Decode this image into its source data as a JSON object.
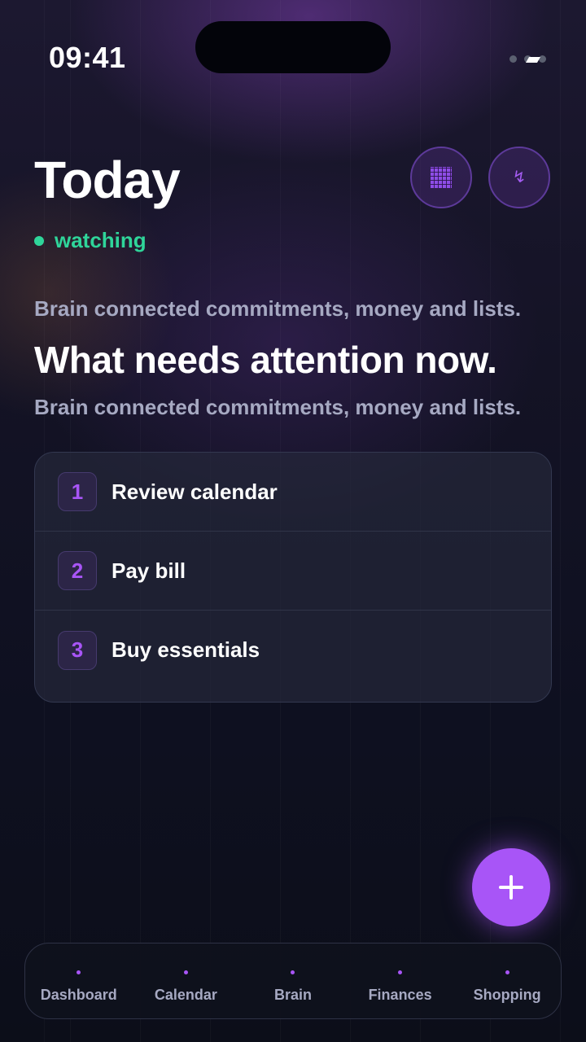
{
  "status_bar": {
    "time": "09:41"
  },
  "header": {
    "title": "Today",
    "status_text": "watching",
    "buttons": [
      {
        "icon": "calendar-grid-icon"
      },
      {
        "icon": "bolt-icon"
      }
    ]
  },
  "intro": {
    "kicker": "Brain connected commitments, money and lists.",
    "headline": "What needs attention now.",
    "subline": "Brain connected commitments, money and lists."
  },
  "tasks": [
    {
      "number": "1",
      "label": "Review calendar"
    },
    {
      "number": "2",
      "label": "Pay bill"
    },
    {
      "number": "3",
      "label": "Buy essentials"
    }
  ],
  "fab": {
    "icon": "plus-icon"
  },
  "nav": {
    "items": [
      {
        "label": "Dashboard"
      },
      {
        "label": "Calendar"
      },
      {
        "label": "Brain"
      },
      {
        "label": "Finances"
      },
      {
        "label": "Shopping"
      }
    ]
  },
  "colors": {
    "accent": "#a855f7",
    "live": "#2fd59a",
    "muted_text": "#a6a9c2",
    "background": "#0f111c"
  }
}
